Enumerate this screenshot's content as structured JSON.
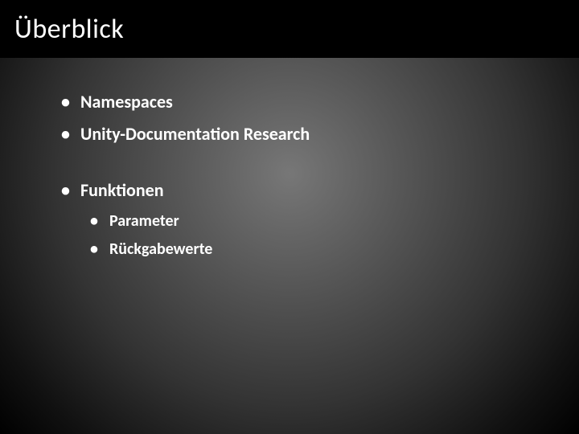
{
  "title": "Überblick",
  "bullets": {
    "b1": "Namespaces",
    "b2": "Unity-Documentation Research",
    "b3": "Funktionen",
    "b3_1": "Parameter",
    "b3_2": "Rückgabewerte"
  }
}
